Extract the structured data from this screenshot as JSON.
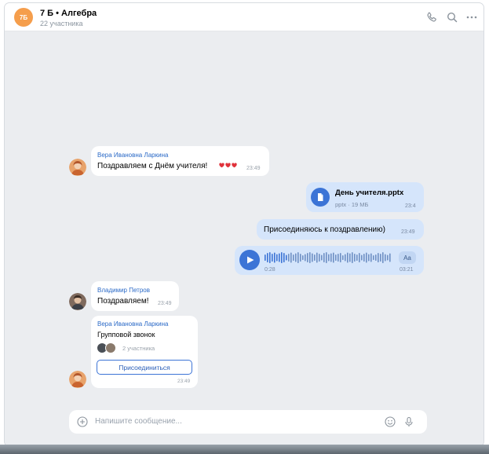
{
  "header": {
    "avatar_text": "7Б",
    "title": "7 Б • Алгебра",
    "subtitle": "22 участника",
    "icons": [
      "phone-icon",
      "search-icon",
      "more-icon"
    ]
  },
  "messages": [
    {
      "type": "incoming-text",
      "sender": "Вера Ивановна Ларкина",
      "text": "Поздравляем с Днём учителя!",
      "emoji": "heart ×3",
      "time": "23:49"
    },
    {
      "type": "outgoing-file",
      "file_name": "День учителя.pptx",
      "file_meta": "pptx · 19 МБ",
      "time": "23:4"
    },
    {
      "type": "outgoing-text",
      "text": "Присоединяюсь к поздравлению)",
      "time": "23:49"
    },
    {
      "type": "outgoing-voice",
      "elapsed": "0:28",
      "duration": "03:21",
      "transcribe_label": "Aa"
    },
    {
      "type": "incoming-text",
      "sender": "Владимир Петров",
      "text": "Поздравляем!",
      "time": "23:49"
    },
    {
      "type": "incoming-call",
      "sender": "Вера Ивановна Ларкина",
      "title": "Групповой звонок",
      "participants": "2 участника",
      "join_label": "Присоединиться",
      "time": "23:49"
    }
  ],
  "composer": {
    "placeholder": "Напишите сообщение..."
  },
  "colors": {
    "background": "#ebedf0",
    "outgoing_bubble": "#d5e5fb",
    "accent": "#3c74d6",
    "sender_name": "#2b6ac7",
    "chat_avatar": "#f59e4c",
    "heart": "#e0313a"
  }
}
